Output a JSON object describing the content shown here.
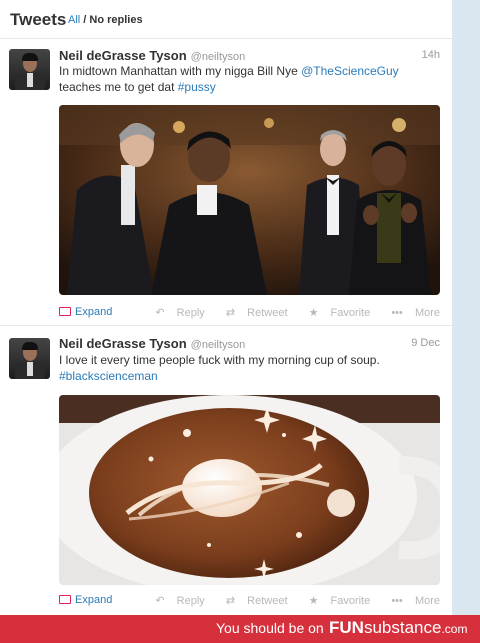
{
  "header": {
    "title": "Tweets",
    "filter_all": "All",
    "filter_separator": " / ",
    "filter_active": "No replies"
  },
  "tweets": [
    {
      "name": "Neil deGrasse Tyson",
      "handle": "@neiltyson",
      "time": "14h",
      "text_line1": "In midtown Manhattan with my nigga Bill Nye ",
      "mention": "@TheScienceGuy",
      "text_line2": "teaches me to get dat ",
      "hashtag": "#pussy",
      "expand": "Expand",
      "reply": "Reply",
      "retweet": "Retweet",
      "favorite": "Favorite",
      "more": "More"
    },
    {
      "name": "Neil deGrasse Tyson",
      "handle": "@neiltyson",
      "time": "9 Dec",
      "text_line1": "I love it every time people fuck with my morning cup of soup.",
      "hashtag": "#blackscienceman",
      "expand": "Expand",
      "reply": "Reply",
      "retweet": "Retweet",
      "favorite": "Favorite",
      "more": "More"
    }
  ],
  "footer": {
    "promo": "You should be on",
    "brand_bold": "FUN",
    "brand_rest": "substance",
    "brand_domain": ".com"
  },
  "colors": {
    "link": "#2b7bb9",
    "footer": "#d7303d",
    "muted": "#999999"
  },
  "icons": {
    "expand": "media-expand-icon",
    "reply": "reply-icon",
    "retweet": "retweet-icon",
    "favorite": "star-icon",
    "more": "more-dots-icon"
  }
}
